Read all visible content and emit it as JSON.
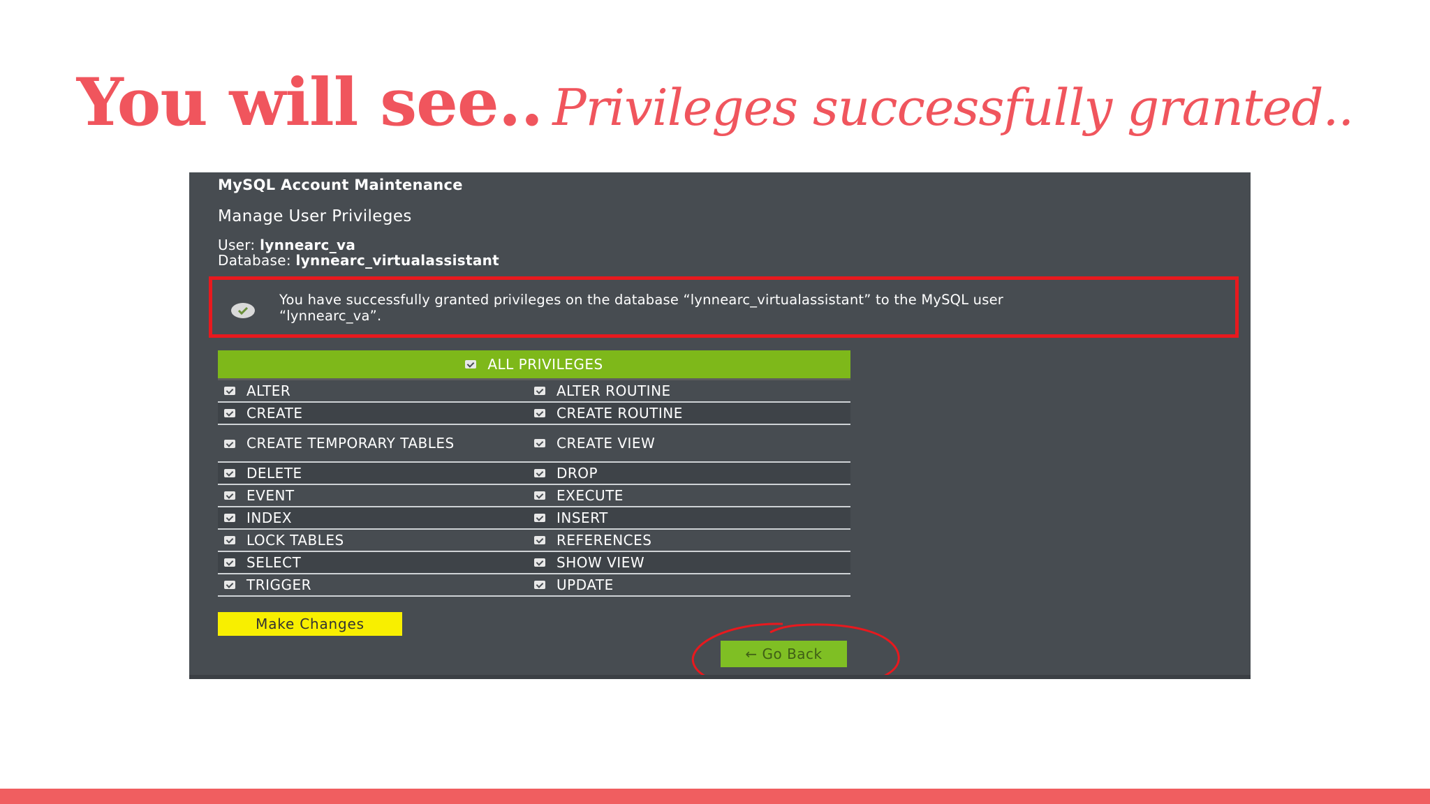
{
  "slide": {
    "title_main": "You will see..",
    "title_italic": "Privileges successfully granted.."
  },
  "screenshot": {
    "section_title": "MySQL Account Maintenance",
    "page_heading": "Manage User Privileges",
    "user_label": "User:",
    "user_value": "lynnearc_va",
    "database_label": "Database:",
    "database_value": "lynnearc_virtualassistant",
    "success_line1": "You have successfully granted privileges on the database “lynnearc_virtualassistant” to the MySQL user",
    "success_line2": "“lynnearc_va”.",
    "all_privileges_label": "ALL PRIVILEGES",
    "privileges": [
      {
        "left": "ALTER",
        "right": "ALTER ROUTINE"
      },
      {
        "left": "CREATE",
        "right": "CREATE ROUTINE"
      },
      {
        "left": "CREATE TEMPORARY TABLES",
        "right": "CREATE VIEW"
      },
      {
        "left": "DELETE",
        "right": "DROP"
      },
      {
        "left": "EVENT",
        "right": "EXECUTE"
      },
      {
        "left": "INDEX",
        "right": "INSERT"
      },
      {
        "left": "LOCK TABLES",
        "right": "REFERENCES"
      },
      {
        "left": "SELECT",
        "right": "SHOW VIEW"
      },
      {
        "left": "TRIGGER",
        "right": "UPDATE"
      }
    ],
    "make_changes_label": "Make Changes",
    "go_back_label": "← Go Back"
  },
  "colors": {
    "accent_red": "#f0555d",
    "panel_bg": "#474c51",
    "success_green": "#7eb81a",
    "button_yellow": "#f8ef00",
    "annotation_red": "#e8191e"
  },
  "icons": [
    "check-circle-icon",
    "checkbox-checked-icon",
    "arrow-left-icon"
  ]
}
